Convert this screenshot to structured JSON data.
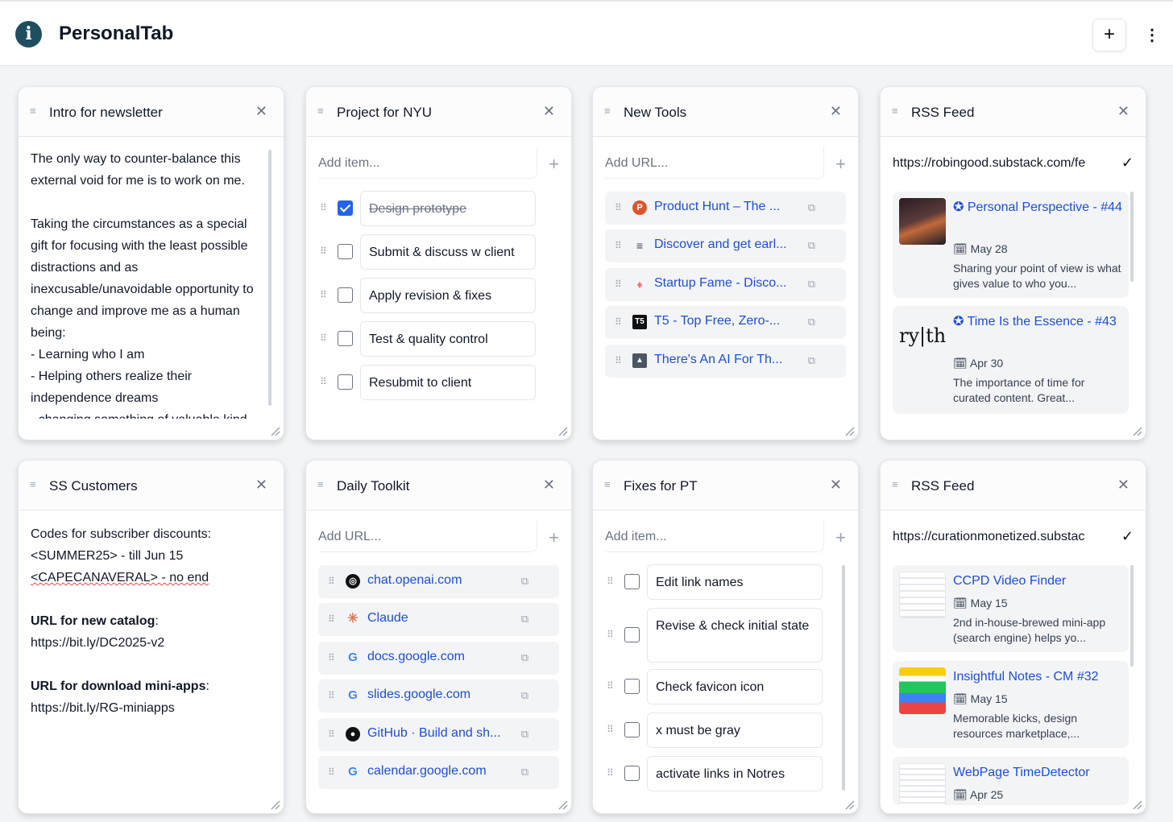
{
  "app": {
    "title": "PersonalTab",
    "add_label": "+",
    "more_label": "⋮"
  },
  "cards": {
    "intro": {
      "title": "Intro for newsletter",
      "body": "The only way to counter-balance this external void for me is to work on me.\n\nTaking the circumstances as a special gift for focusing with the least possible distractions and as inexcusable/unavoidable opportunity to change and improve me as a human being:\n- Learning who I am\n- Helping others realize their independence dreams\n- changing something of valuable kind"
    },
    "nyu": {
      "title": "Project for NYU",
      "placeholder": "Add item...",
      "items": [
        {
          "label": "Design prototype",
          "checked": true
        },
        {
          "label": "Submit & discuss w client",
          "checked": false
        },
        {
          "label": "Apply revision & fixes",
          "checked": false
        },
        {
          "label": "Test & quality control",
          "checked": false
        },
        {
          "label": "Resubmit to client",
          "checked": false
        }
      ]
    },
    "tools": {
      "title": "New Tools",
      "placeholder": "Add URL...",
      "links": [
        {
          "label": "Product Hunt – The ...",
          "icon": "product-hunt-icon",
          "color": "#da552f",
          "glyph": "P"
        },
        {
          "label": "Discover and get earl...",
          "icon": "lines-icon",
          "color": "#374151",
          "glyph": "≡"
        },
        {
          "label": "Startup Fame - Disco...",
          "icon": "flame-icon",
          "color": "#f87171",
          "glyph": "♦"
        },
        {
          "label": "T5 - Top Free, Zero-...",
          "icon": "t5-icon",
          "color": "#111111",
          "glyph": "T5"
        },
        {
          "label": "There's An AI For Th...",
          "icon": "ai-image-icon",
          "color": "#6b7280",
          "glyph": "▲"
        }
      ]
    },
    "rss1": {
      "title": "RSS Feed",
      "url": "https://robingood.substack.com/fe",
      "items": [
        {
          "title": "✪ Personal Perspective - #44",
          "date": "May 28",
          "excerpt": "Sharing your point of view is what gives value to who you..."
        },
        {
          "title": "✪ Time Is the Essence - #43",
          "date": "Apr 30",
          "excerpt": "The importance of time for curated content. Great..."
        }
      ],
      "thumb_text": "ry|thi"
    },
    "ss": {
      "title": "SS Customers",
      "line1": "Codes for subscriber discounts:",
      "line2": "<SUMMER25> - till Jun 15",
      "line3": "<CAPECANAVERAL> - no end",
      "catalog_label": "URL for new catalog",
      "catalog_url": "https://bit.ly/DC2025-v2",
      "apps_label": "URL for download mini-apps",
      "apps_url": "https://bit.ly/RG-miniapps"
    },
    "toolkit": {
      "title": "Daily Toolkit",
      "placeholder": "Add URL...",
      "links": [
        {
          "label": "chat.openai.com",
          "icon": "openai-icon",
          "color": "#111111",
          "glyph": "◎"
        },
        {
          "label": "Claude",
          "icon": "claude-icon",
          "color": "#d97757",
          "glyph": "✳"
        },
        {
          "label": "docs.google.com",
          "icon": "google-icon",
          "color": "#4285f4",
          "glyph": "G"
        },
        {
          "label": "slides.google.com",
          "icon": "google-icon",
          "color": "#4285f4",
          "glyph": "G"
        },
        {
          "label": "GitHub · Build and sh...",
          "icon": "github-icon",
          "color": "#111111",
          "glyph": "●"
        },
        {
          "label": "calendar.google.com",
          "icon": "google-icon",
          "color": "#4285f4",
          "glyph": "G"
        }
      ]
    },
    "fixes": {
      "title": "Fixes for PT",
      "placeholder": "Add item...",
      "items": [
        {
          "label": "Edit link names",
          "checked": false
        },
        {
          "label": "Revise & check initial state",
          "checked": false
        },
        {
          "label": "Check favicon icon",
          "checked": false
        },
        {
          "label": "x must be gray",
          "checked": false
        },
        {
          "label": "activate links in Notres",
          "checked": false
        }
      ]
    },
    "rss2": {
      "title": "RSS Feed",
      "url": "https://curationmonetized.substac",
      "items": [
        {
          "title": "CCPD Video Finder",
          "date": "May 15",
          "excerpt": "2nd in-house-brewed mini-app (search engine) helps yo..."
        },
        {
          "title": "Insightful Notes - CM #32",
          "date": "May 15",
          "excerpt": "Memorable kicks, design resources marketplace,..."
        },
        {
          "title": "WebPage TimeDetector",
          "date": "Apr 25",
          "excerpt": ""
        }
      ]
    }
  },
  "colors": {
    "link": "#1d4ed8",
    "accent": "#2563eb",
    "logo": "#1f4e5f"
  }
}
